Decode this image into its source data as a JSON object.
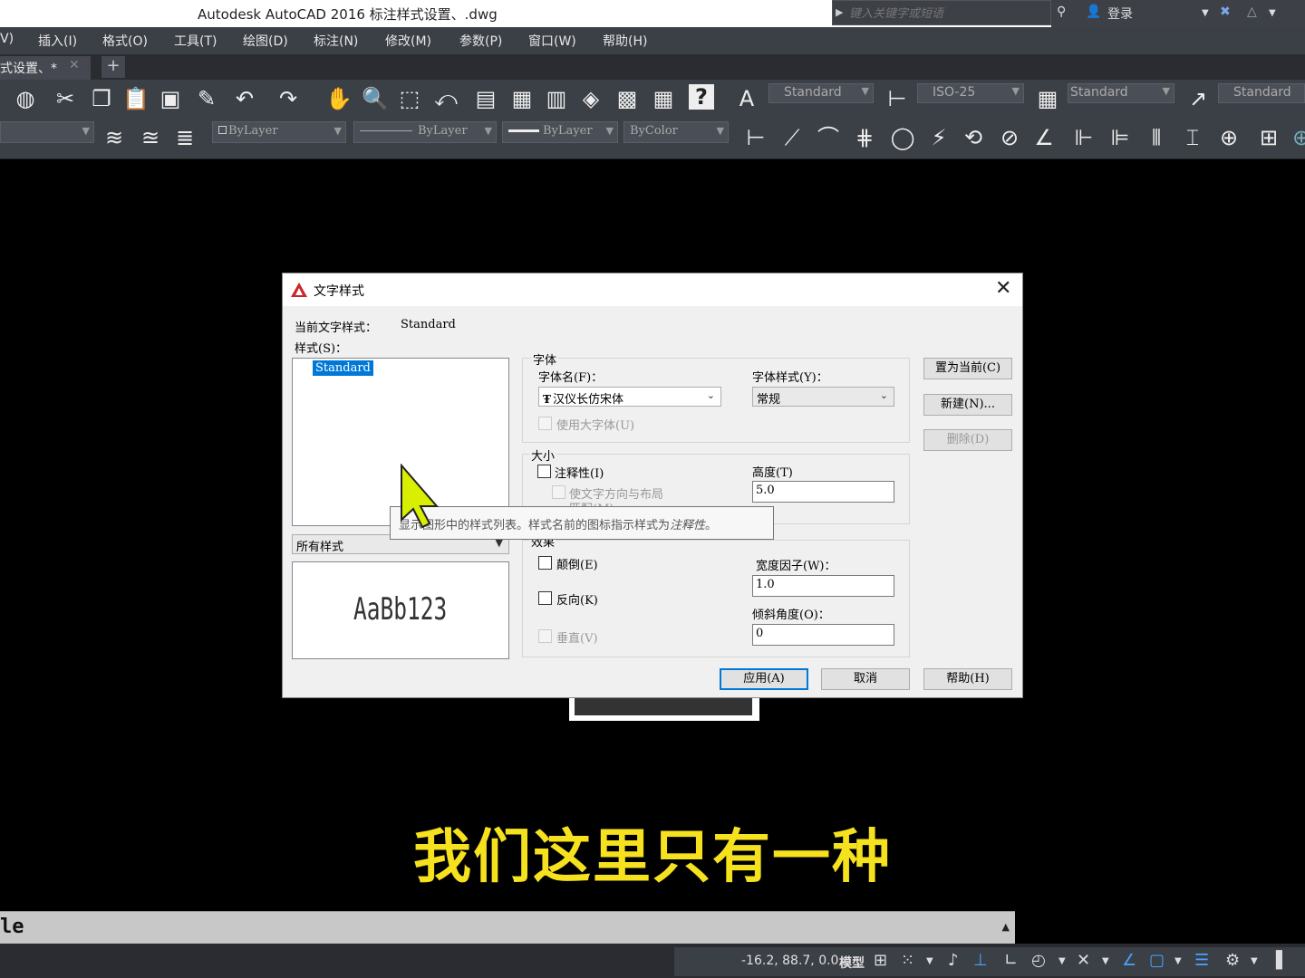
{
  "window": {
    "title": "Autodesk AutoCAD 2016    标注样式设置、.dwg",
    "search_placeholder": "键入关键字或短语",
    "login_label": "登录"
  },
  "menu": [
    "V)",
    "插入(I)",
    "格式(O)",
    "工具(T)",
    "绘图(D)",
    "标注(N)",
    "修改(M)",
    "参数(P)",
    "窗口(W)",
    "帮助(H)"
  ],
  "tabs": {
    "active_label": "式设置、*",
    "close_glyph": "✕",
    "new_tab_glyph": "+"
  },
  "toolbar": {
    "text_style": "Standard",
    "dim_style": "ISO-25",
    "table_style": "Standard",
    "multileader_style": "Standard",
    "color": "ByLayer",
    "linetype": "ByLayer",
    "lineweight": "ByLayer",
    "plotstyle": "ByColor",
    "help_glyph": "?"
  },
  "dialog": {
    "title": "文字样式",
    "current_style_label": "当前文字样式：",
    "current_style_value": "Standard",
    "styles_label": "样式(S)：",
    "styles_list": [
      "Standard"
    ],
    "filter_value": "所有样式",
    "preview_text": "AaBb123",
    "font_group": "字体",
    "font_name_label": "字体名(F)：",
    "font_name_value": "汉仪长仿宋体",
    "font_style_label": "字体样式(Y)：",
    "font_style_value": "常规",
    "bigfont_label": "使用大字体(U)",
    "size_group": "大小",
    "annotative_label": "注释性(I)",
    "orient_label": "使文字方向与布局",
    "orient_label2": "匹配(M)",
    "height_label": "高度(T)",
    "height_value": "5.0",
    "effects_group": "效果",
    "upside_down_label": "颠倒(E)",
    "backwards_label": "反向(K)",
    "vertical_label": "垂直(V)",
    "width_factor_label": "宽度因子(W)：",
    "width_factor_value": "1.0",
    "oblique_label": "倾斜角度(O)：",
    "oblique_value": "0",
    "set_current_btn": "置为当前(C)",
    "new_btn": "新建(N)...",
    "delete_btn": "删除(D)",
    "apply_btn": "应用(A)",
    "cancel_btn": "取消",
    "help_btn": "帮助(H)",
    "close_glyph": "✕"
  },
  "tooltip": {
    "text": "显示图形中的样式列表。样式名前的图标指示样式为",
    "italic": "注释性",
    "end": "。"
  },
  "subtitle": "我们这里只有一种",
  "command_line": {
    "text": "le"
  },
  "status": {
    "coords": "-16.2, 88.7, 0.0",
    "model": "模型"
  },
  "colors": {
    "subtitle": "#f5e11e",
    "selection": "#0078d7",
    "autocad_red": "#c8262b"
  }
}
